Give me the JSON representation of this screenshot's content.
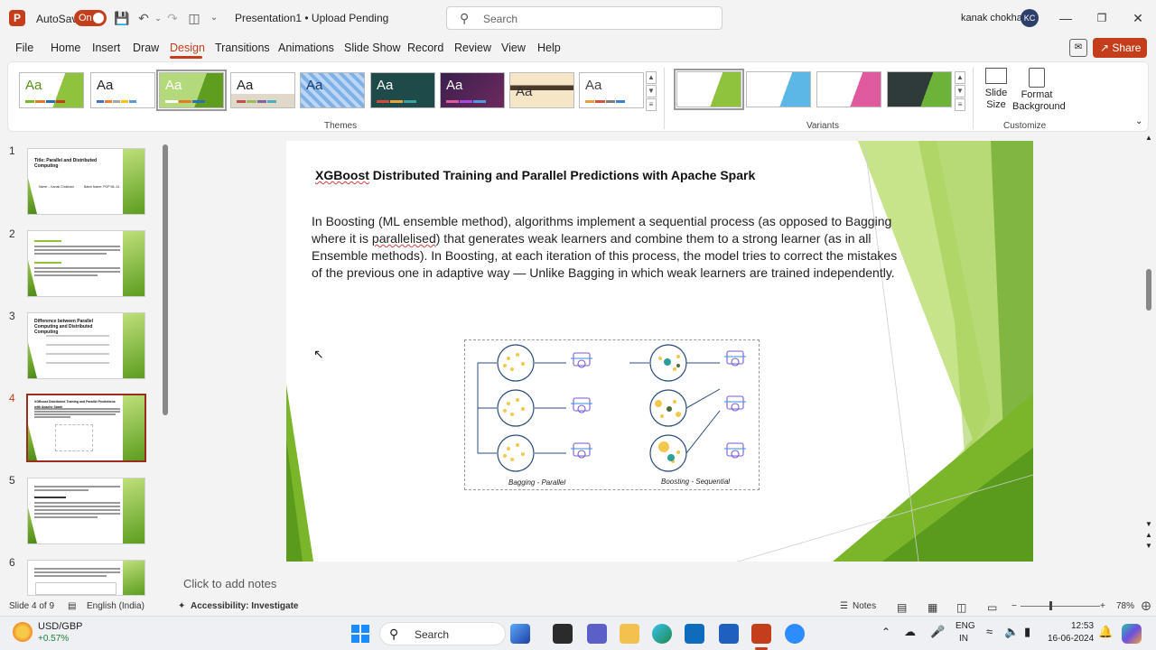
{
  "titlebar": {
    "app_logo": "P",
    "autosave_label": "AutoSave",
    "autosave_state": "On",
    "doc_title": "Presentation1 • Upload Pending",
    "search_placeholder": "Search",
    "user_name": "kanak chokhani",
    "user_initials": "KC"
  },
  "menu": {
    "items": [
      "File",
      "Home",
      "Insert",
      "Draw",
      "Design",
      "Transitions",
      "Animations",
      "Slide Show",
      "Record",
      "Review",
      "View",
      "Help"
    ],
    "active": "Design",
    "share_label": "Share"
  },
  "ribbon": {
    "themes_label": "Themes",
    "variants_label": "Variants",
    "customize_label": "Customize",
    "theme_sample": "Aa",
    "slide_size_label": "Slide Size",
    "format_bg_label": "Format Background"
  },
  "slides": {
    "thumbs": [
      {
        "num": "1",
        "title": "Title: Parallel and Distributed Computing",
        "subtitle_left": "Name – Kanak Chokhani",
        "subtitle_right": "Batch Name: PGP ML-31"
      },
      {
        "num": "2",
        "title": ""
      },
      {
        "num": "3",
        "title": "Difference between Parallel Computing and Distributed Computing"
      },
      {
        "num": "4",
        "title": "XGBoost Distributed Training and Parallel Predictions with Apache Spark"
      },
      {
        "num": "5",
        "title": ""
      },
      {
        "num": "6",
        "title": ""
      }
    ],
    "selected": 4
  },
  "slide": {
    "title_word": "XGBoost",
    "title_rest": " Distributed Training and Parallel Predictions with Apache Spark",
    "body_1": "In Boosting (ML ensemble method), algorithms implement a sequential process (as opposed to Bagging where it is ",
    "body_spell": "parallelised",
    "body_2": ") that generates weak learners and combine them to a strong learner (as in all Ensemble methods). In Boosting, at each iteration of this process, the model tries to correct the mistakes of the previous one in adaptive way — Unlike Bagging in which weak learners are trained independently.",
    "caption_left": "Bagging - Parallel",
    "caption_right": "Boosting - Sequential"
  },
  "notes_placeholder": "Click to add notes",
  "status": {
    "slide_of": "Slide 4 of 9",
    "language": "English (India)",
    "accessibility": "Accessibility: Investigate",
    "notes_label": "Notes",
    "zoom": "78%"
  },
  "taskbar": {
    "ticker_name": "USD/GBP",
    "ticker_change": "+0.57%",
    "search_placeholder": "Search",
    "lang_top": "ENG",
    "lang_bottom": "IN",
    "time": "12:53",
    "date": "16-06-2024"
  },
  "colors": {
    "accent": "#c43e1c",
    "slide_green": "#7ab52a"
  }
}
